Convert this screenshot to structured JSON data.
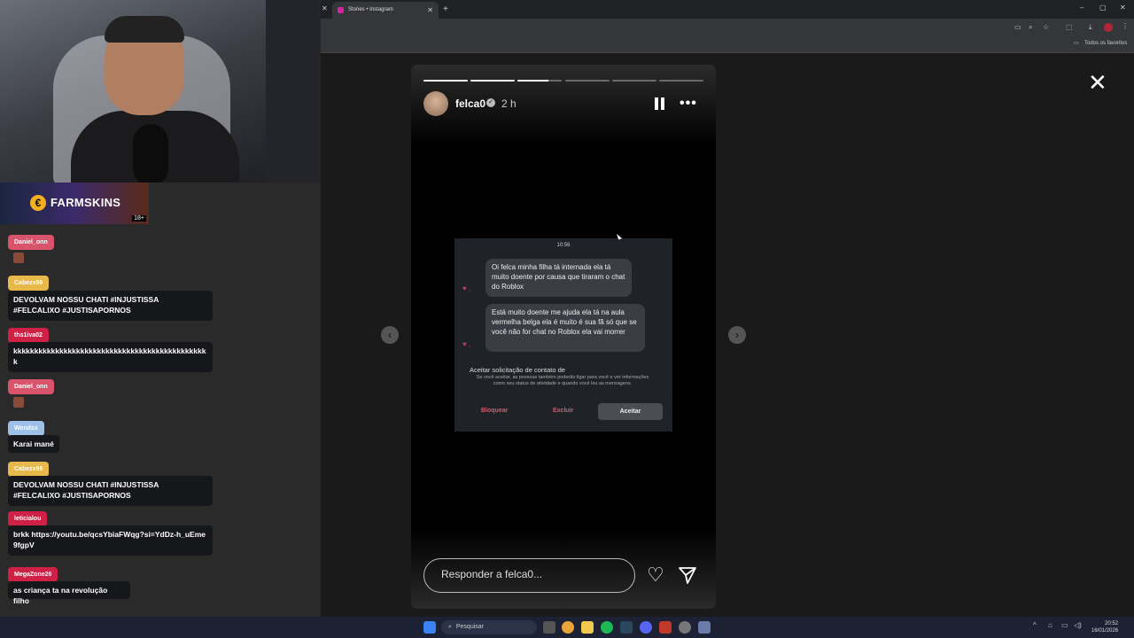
{
  "browser": {
    "tab_title": "Stories • Instagram",
    "tab_close": "✕",
    "new_tab": "+",
    "bookmarks_folder": "Todos os favoritos",
    "window_controls": [
      "–",
      "▢",
      "✕"
    ]
  },
  "sponsor": {
    "name": "FARMSKINS",
    "age": "18+"
  },
  "chat": [
    {
      "user": "Daniel_onn",
      "color": "#d9536a",
      "message": "",
      "emote": true
    },
    {
      "user": "Cabezx99",
      "color": "#e8b84a",
      "message": "DEVOLVAM NOSSU CHATI #INJUSTISSA #FELCALIXO #JUSTISAPORNOS"
    },
    {
      "user": "ths1iva02",
      "color": "#cf2045",
      "message": "kkkkkkkkkkkkkkkkkkkkkkkkkkkkkkkkkkkkkkkkkkkkkkk"
    },
    {
      "user": "Daniel_onn",
      "color": "#d9536a",
      "message": "",
      "emote": true
    },
    {
      "user": "Wendsx",
      "color": "#9dc0e8",
      "message": "Karai mané"
    },
    {
      "user": "Cabezx99",
      "color": "#e8b84a",
      "message": "DEVOLVAM NOSSU CHATI #INJUSTISSA #FELCALIXO #JUSTISAPORNOS"
    },
    {
      "user": "leticialou",
      "color": "#cf2045",
      "message": "brkk https://youtu.be/qcsYbiaFWqg?si=YdDz-h_uEme9fgpV"
    },
    {
      "user": "MegaZone26",
      "color": "#cf2045",
      "message": "as criança ta na revolução filho"
    }
  ],
  "story": {
    "username": "felca0",
    "verified_mark": "✓",
    "time_ago": "2 h",
    "more": "•••",
    "progress_segments": [
      1,
      1,
      0.7,
      0,
      0,
      0
    ],
    "reply_placeholder": "Responder a felca0...",
    "close": "✕",
    "prev_arrow": "‹",
    "next_arrow": "›"
  },
  "screenshot": {
    "clock": "10:56",
    "messages": [
      "Oi felca minha filha tá internada ela tá muito doente por causa que tiraram o chat do Roblox",
      "Está muito doente me ajuda ela tá na aula vermelha belga ela é muito é sua fã só que se você não for chat no Roblox ela vai morrer"
    ],
    "request_title": "Aceitar solicitação de contato de",
    "request_desc": "Se você aceitar, as pessoas também poderão ligar para você e ver informações como seu status de atividade e quando você leu as mensagens.",
    "block_label": "Bloquear",
    "delete_label": "Excluir",
    "accept_label": "Aceitar"
  },
  "taskbar": {
    "search_label": "Pesquisar",
    "time": "20:52",
    "date": "16/01/2026"
  },
  "colors": {
    "story_bg": "#000000",
    "accent_red": "#e2566f",
    "page_bg": "#1a1a1a"
  }
}
